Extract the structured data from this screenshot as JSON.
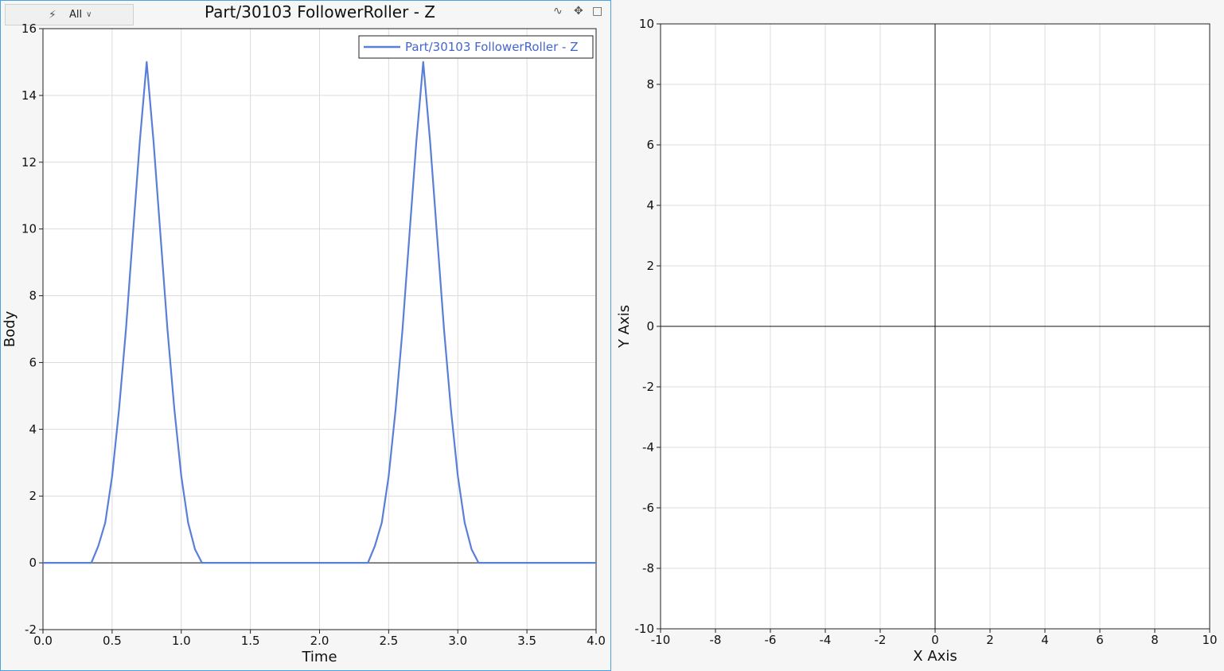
{
  "toolbar": {
    "filter_label": "All"
  },
  "chart_data": [
    {
      "type": "line",
      "title": "Part/30103 FollowerRoller - Z",
      "xlabel": "Time",
      "ylabel": "Body",
      "xlim": [
        0.0,
        4.0
      ],
      "ylim": [
        -2,
        16
      ],
      "xticks": [
        "0.0",
        "0.5",
        "1.0",
        "1.5",
        "2.0",
        "2.5",
        "3.0",
        "3.5",
        "4.0"
      ],
      "yticks": [
        "-2",
        "0",
        "2",
        "4",
        "6",
        "8",
        "10",
        "12",
        "14",
        "16"
      ],
      "grid": true,
      "legend_position": "top-right",
      "series_color": "#5a7fd6",
      "series": [
        {
          "name": "Part/30103 FollowerRoller - Z",
          "x": [
            0.0,
            0.35,
            0.4,
            0.45,
            0.5,
            0.55,
            0.6,
            0.65,
            0.7,
            0.75,
            0.8,
            0.85,
            0.9,
            0.95,
            1.0,
            1.05,
            1.1,
            1.15,
            1.2,
            2.35,
            2.4,
            2.45,
            2.5,
            2.55,
            2.6,
            2.65,
            2.7,
            2.75,
            2.8,
            2.85,
            2.9,
            2.95,
            3.0,
            3.05,
            3.1,
            3.15,
            3.2,
            4.0
          ],
          "y": [
            0.0,
            0.0,
            0.5,
            1.2,
            2.6,
            4.6,
            7.0,
            9.8,
            12.6,
            15.0,
            12.6,
            9.8,
            7.0,
            4.6,
            2.6,
            1.2,
            0.4,
            0.0,
            0.0,
            0.0,
            0.5,
            1.2,
            2.6,
            4.6,
            7.0,
            9.8,
            12.6,
            15.0,
            12.6,
            9.8,
            7.0,
            4.6,
            2.6,
            1.2,
            0.4,
            0.0,
            0.0,
            0.0
          ]
        }
      ]
    },
    {
      "type": "line",
      "title": "",
      "xlabel": "X Axis",
      "ylabel": "Y Axis",
      "xlim": [
        -10,
        10
      ],
      "ylim": [
        -10,
        10
      ],
      "xticks": [
        "-10",
        "-8",
        "-6",
        "-4",
        "-2",
        "0",
        "2",
        "4",
        "6",
        "8",
        "10"
      ],
      "yticks": [
        "-10",
        "-8",
        "-6",
        "-4",
        "-2",
        "0",
        "2",
        "4",
        "6",
        "8",
        "10"
      ],
      "grid": true,
      "series": []
    }
  ]
}
